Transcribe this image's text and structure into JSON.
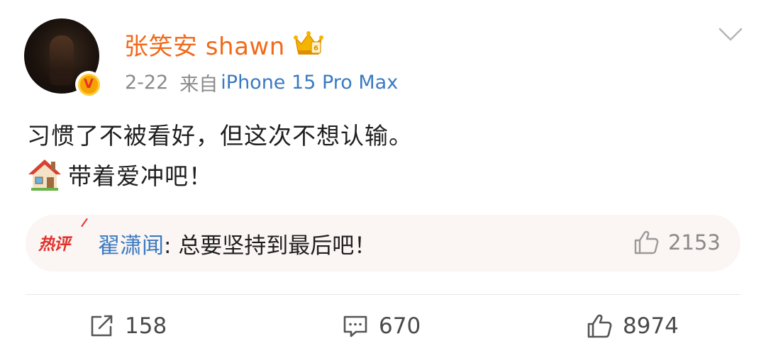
{
  "header": {
    "username": "张笑安 shawn",
    "date": "2-22",
    "source_prefix": "来自",
    "device": "iPhone 15 Pro Max",
    "verified_mark": "V"
  },
  "post": {
    "line1": "习惯了不被看好，但这次不想认输。",
    "line2": "带着爱冲吧！"
  },
  "hot_comment": {
    "tag": "热评",
    "author": "翟潇闻",
    "separator": ": ",
    "text": "总要坚持到最后吧！",
    "like_count": "2153"
  },
  "actions": {
    "repost_count": "158",
    "comment_count": "670",
    "like_count": "8974"
  },
  "icons": {
    "chevron": "chevron-down-icon",
    "crown": "crown-badge-icon",
    "house": "house-emoji-icon",
    "repost": "repost-icon",
    "comment": "comment-icon",
    "like": "thumbs-up-icon"
  },
  "colors": {
    "username": "#f06a1a",
    "link_blue": "#3a7ac0",
    "hot_red": "#e0302b",
    "meta_gray": "#8a8a8a",
    "comment_bg": "#fbf5f3"
  }
}
